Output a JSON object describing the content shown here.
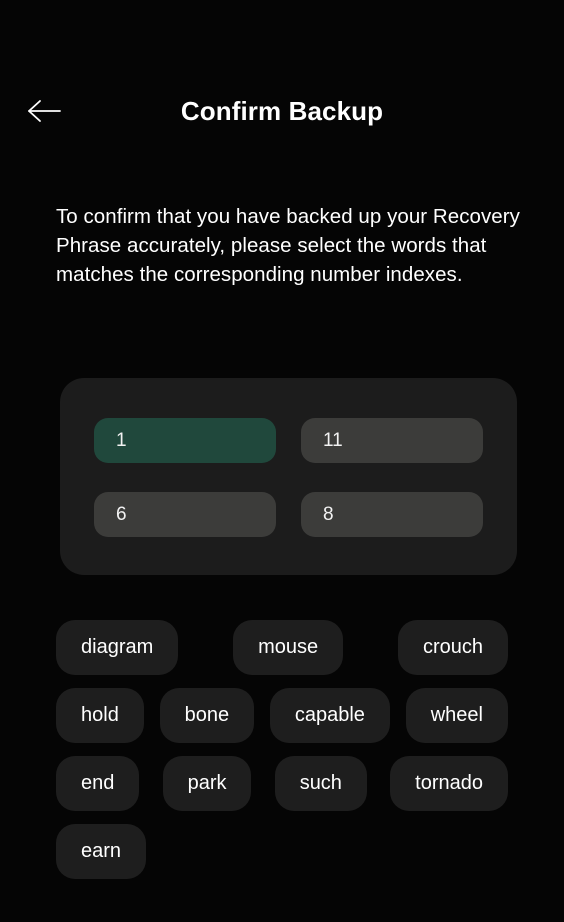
{
  "header": {
    "back_icon": "arrow-left-icon",
    "title": "Confirm Backup"
  },
  "description": {
    "text": "To confirm that you have backed up your Recovery Phrase accurately, please select the words that matches the corresponding number indexes."
  },
  "slot_panel": {
    "slots": [
      {
        "index_label": "1",
        "state": "filled",
        "value": ""
      },
      {
        "index_label": "11",
        "state": "empty",
        "value": ""
      },
      {
        "index_label": "6",
        "state": "empty",
        "value": ""
      },
      {
        "index_label": "8",
        "state": "empty",
        "value": ""
      }
    ]
  },
  "word_bank": {
    "rows": [
      {
        "words": [
          "diagram",
          "mouse",
          "crouch"
        ]
      },
      {
        "words": [
          "hold",
          "bone",
          "capable",
          "wheel"
        ]
      },
      {
        "words": [
          "end",
          "park",
          "such",
          "tornado"
        ]
      },
      {
        "words": [
          "earn"
        ]
      }
    ]
  },
  "colors": {
    "background": "#050505",
    "panel": "#1c1c1c",
    "slot_empty": "#3c3c3a",
    "slot_filled": "#20483c",
    "chip": "#1e1e1e",
    "text": "#ffffff"
  }
}
